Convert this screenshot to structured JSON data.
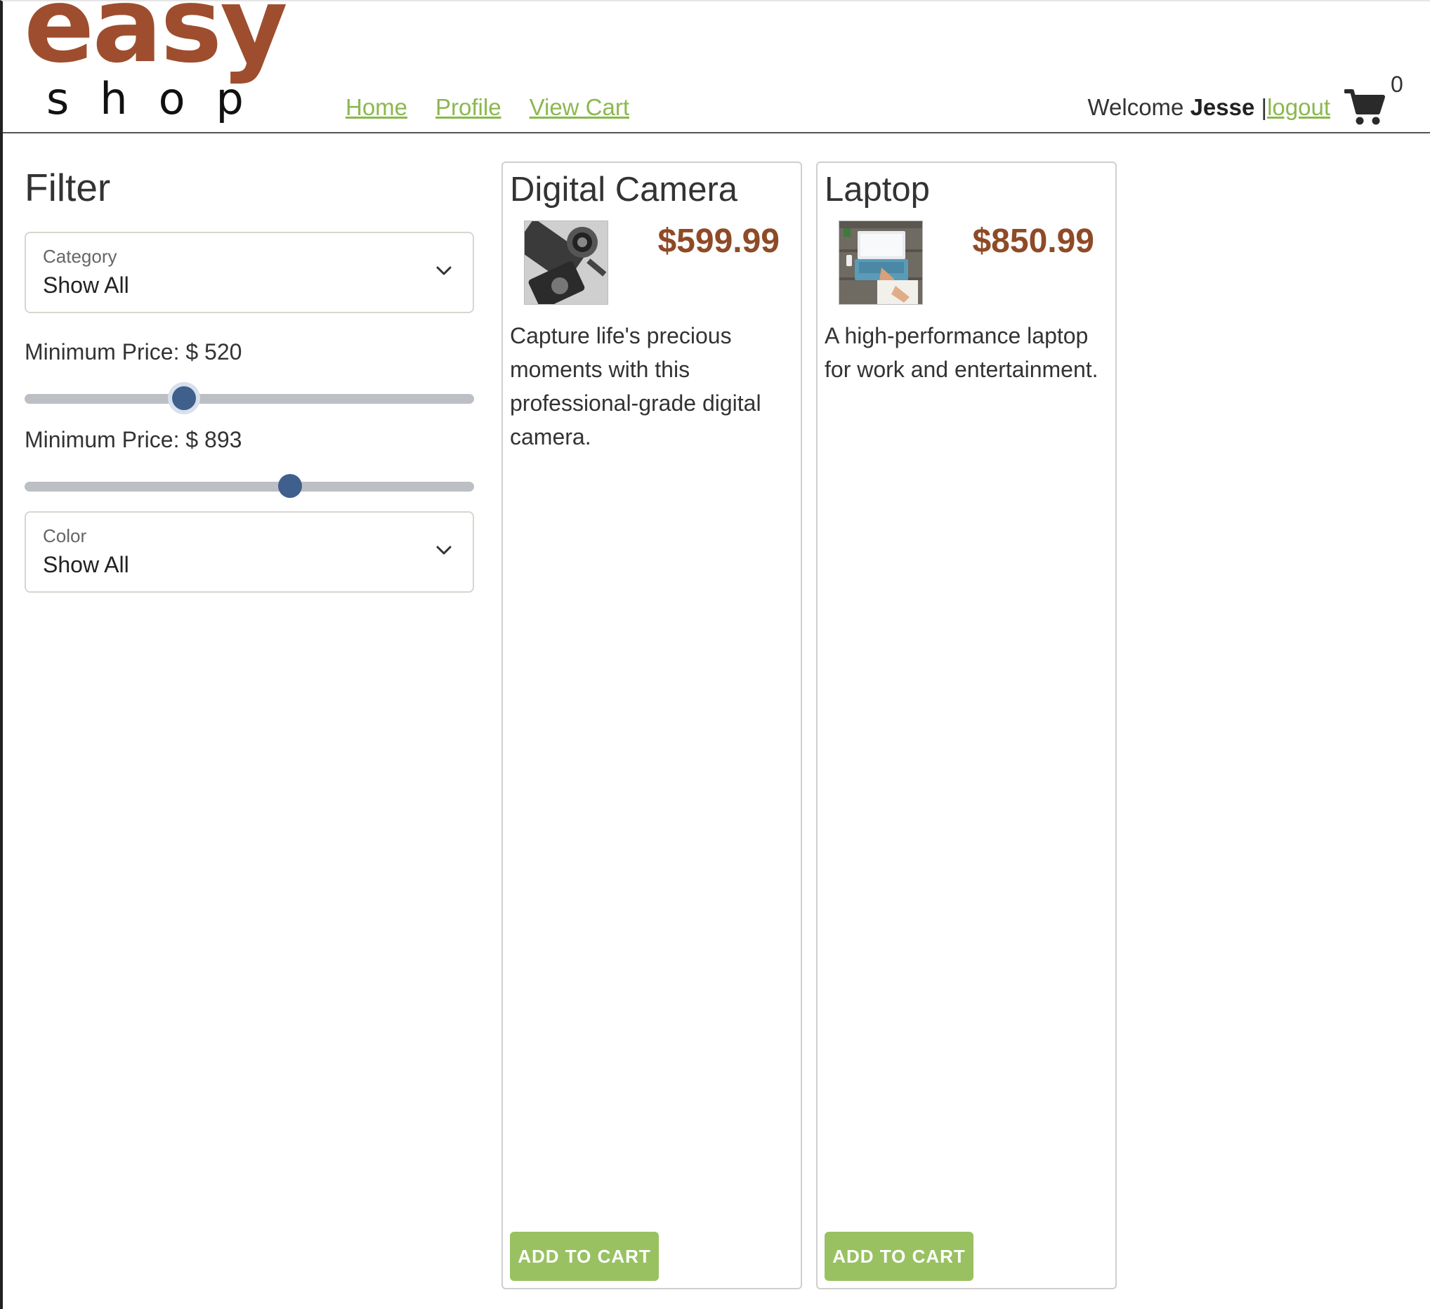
{
  "brand": {
    "logo_word": "easy",
    "logo_subword": "shop"
  },
  "nav": {
    "home": "Home",
    "profile": "Profile",
    "view_cart": "View Cart"
  },
  "user": {
    "welcome": "Welcome",
    "name": "Jesse",
    "separator": "|",
    "logout": "logout",
    "cart_count": "0"
  },
  "filter": {
    "title": "Filter",
    "category": {
      "label": "Category",
      "value": "Show All"
    },
    "min_price": {
      "label": "Minimum Price: $ 520",
      "value": 520
    },
    "max_price": {
      "label": "Minimum Price: $ 893",
      "value": 893
    },
    "color": {
      "label": "Color",
      "value": "Show All"
    }
  },
  "products": [
    {
      "name": "Digital Camera",
      "price": "$599.99",
      "description": "Capture life's precious moments with this professional-grade digital camera.",
      "button": "ADD TO CART",
      "image_icon": "camera-photo"
    },
    {
      "name": "Laptop",
      "price": "$850.99",
      "description": "A high-performance laptop for work and entertainment.",
      "button": "ADD TO CART",
      "image_icon": "laptop-photo"
    }
  ],
  "colors": {
    "brand_brown": "#9e4e2e",
    "link_green": "#8bb84e",
    "button_green": "#99c161",
    "price_brown": "#8f4a26",
    "slider_blue": "#3f5f8c"
  }
}
